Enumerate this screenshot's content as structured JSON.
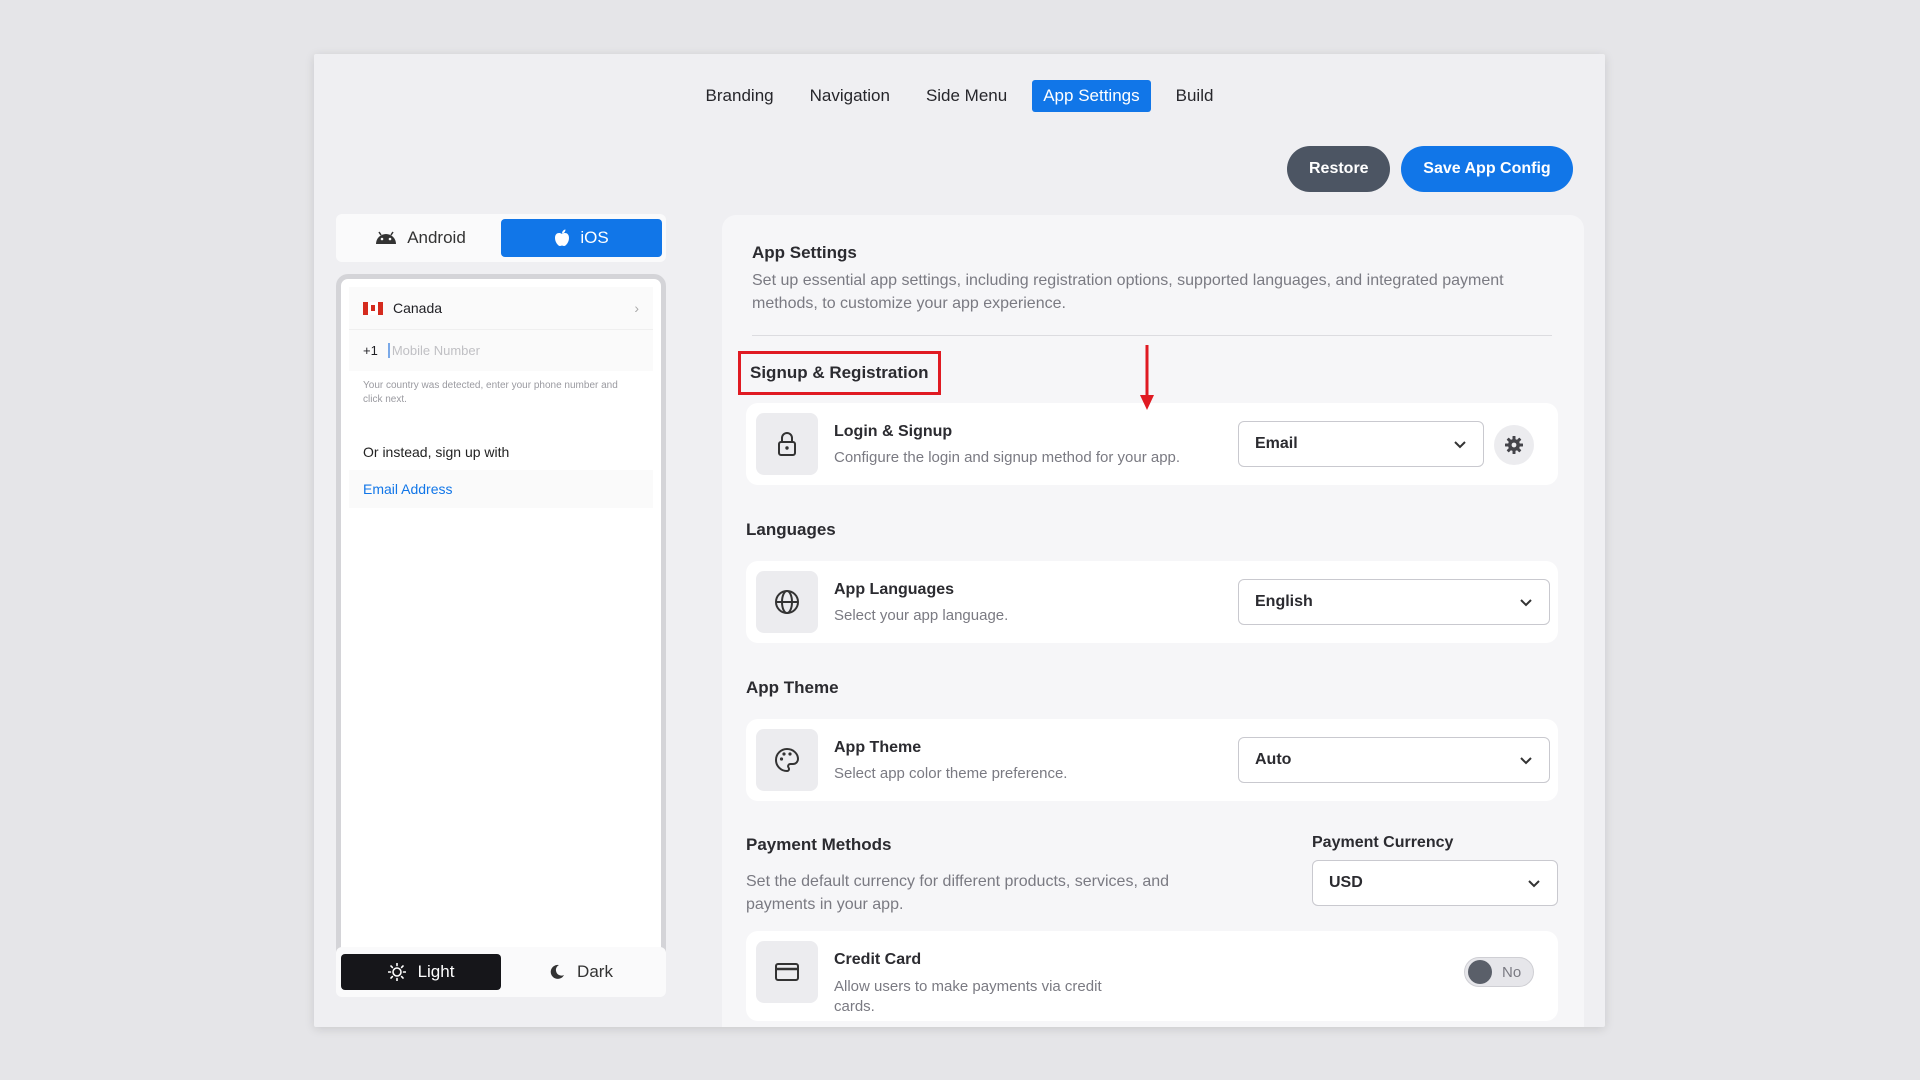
{
  "top_tabs": [
    {
      "label": "Branding"
    },
    {
      "label": "Navigation"
    },
    {
      "label": "Side Menu"
    },
    {
      "label": "App Settings",
      "active": true
    },
    {
      "label": "Build"
    }
  ],
  "actions": {
    "restore": "Restore",
    "save": "Save App Config"
  },
  "preview": {
    "platforms": {
      "android": "Android",
      "ios": "iOS",
      "selected": "iOS"
    },
    "country": "Canada",
    "dial_code": "+1",
    "phone_placeholder": "Mobile Number",
    "hint": "Your country was detected, enter your phone number and click next.",
    "alt_signup": "Or instead, sign up with",
    "email_link": "Email Address",
    "themes": {
      "light": "Light",
      "dark": "Dark",
      "selected": "Light"
    }
  },
  "panel": {
    "title": "App Settings",
    "description": "Set up essential app settings, including registration options, supported languages, and integrated payment methods, to customize your app experience.",
    "signup": {
      "section": "Signup & Registration",
      "title": "Login & Signup",
      "subtitle": "Configure the login and signup method for your app.",
      "value": "Email"
    },
    "languages": {
      "section": "Languages",
      "title": "App Languages",
      "subtitle": "Select your app language.",
      "value": "English"
    },
    "theme": {
      "section": "App Theme",
      "title": "App Theme",
      "subtitle": "Select app color theme preference.",
      "value": "Auto"
    },
    "payment": {
      "section": "Payment Methods",
      "description": "Set the default currency for different products, services, and payments in your app.",
      "currency_label": "Payment Currency",
      "currency_value": "USD",
      "credit_title": "Credit Card",
      "credit_subtitle": "Allow users to make payments via credit cards.",
      "credit_toggle": "No"
    }
  },
  "colors": {
    "accent": "#1176e8",
    "highlight": "#e01a22",
    "dark": "#16161a"
  }
}
